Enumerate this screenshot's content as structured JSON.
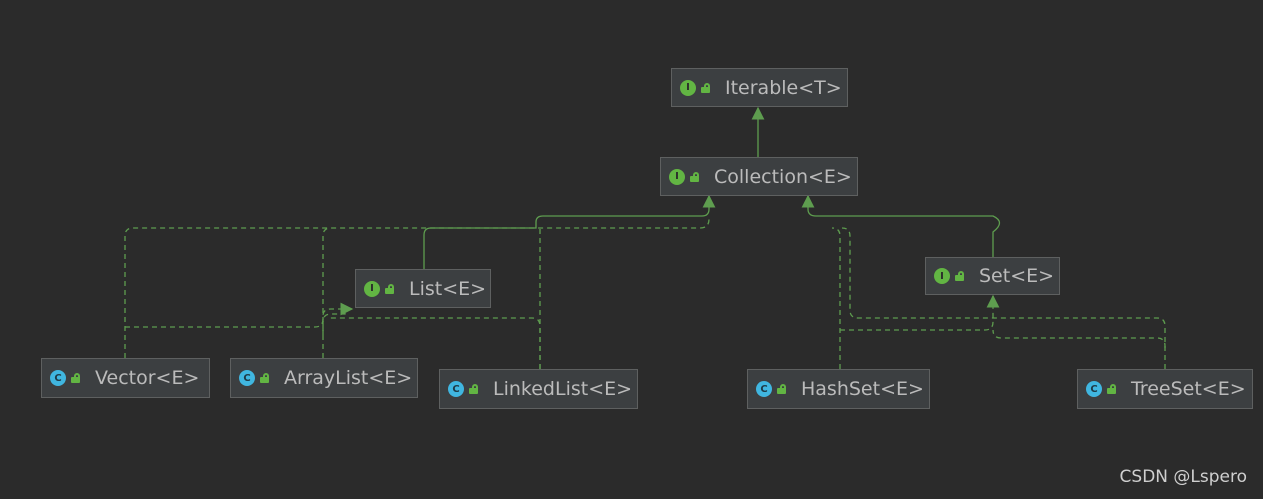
{
  "colors": {
    "background": "#2b2b2b",
    "node_fill": "#3c3f41",
    "node_border": "#5e6060",
    "node_text": "#bbbbbb",
    "edge": "#5e9d4f",
    "interface_badge": "#62b543",
    "class_badge": "#40b6e0"
  },
  "nodes": {
    "iterable": {
      "label": "Iterable<T>",
      "kind": "interface",
      "kind_letter": "I",
      "icon": "interface-icon"
    },
    "collection": {
      "label": "Collection<E>",
      "kind": "interface",
      "kind_letter": "I",
      "icon": "interface-icon"
    },
    "list": {
      "label": "List<E>",
      "kind": "interface",
      "kind_letter": "I",
      "icon": "interface-icon"
    },
    "set": {
      "label": "Set<E>",
      "kind": "interface",
      "kind_letter": "I",
      "icon": "interface-icon"
    },
    "vector": {
      "label": "Vector<E>",
      "kind": "class",
      "kind_letter": "C",
      "icon": "class-icon"
    },
    "arraylist": {
      "label": "ArrayList<E>",
      "kind": "class",
      "kind_letter": "C",
      "icon": "class-icon"
    },
    "linkedlist": {
      "label": "LinkedList<E>",
      "kind": "class",
      "kind_letter": "C",
      "icon": "class-icon"
    },
    "hashset": {
      "label": "HashSet<E>",
      "kind": "class",
      "kind_letter": "C",
      "icon": "class-icon"
    },
    "treeset": {
      "label": "TreeSet<E>",
      "kind": "class",
      "kind_letter": "C",
      "icon": "class-icon"
    }
  },
  "edges": [
    {
      "from": "collection",
      "to": "iterable",
      "type": "extends"
    },
    {
      "from": "list",
      "to": "collection",
      "type": "extends"
    },
    {
      "from": "set",
      "to": "collection",
      "type": "extends"
    },
    {
      "from": "vector",
      "to": "list",
      "type": "implements"
    },
    {
      "from": "arraylist",
      "to": "list",
      "type": "implements"
    },
    {
      "from": "linkedlist",
      "to": "list",
      "type": "implements"
    },
    {
      "from": "linkedlist",
      "to": "collection",
      "type": "implements"
    },
    {
      "from": "hashset",
      "to": "set",
      "type": "implements"
    },
    {
      "from": "treeset",
      "to": "set",
      "type": "implements"
    }
  ],
  "watermark": "CSDN @Lspero"
}
